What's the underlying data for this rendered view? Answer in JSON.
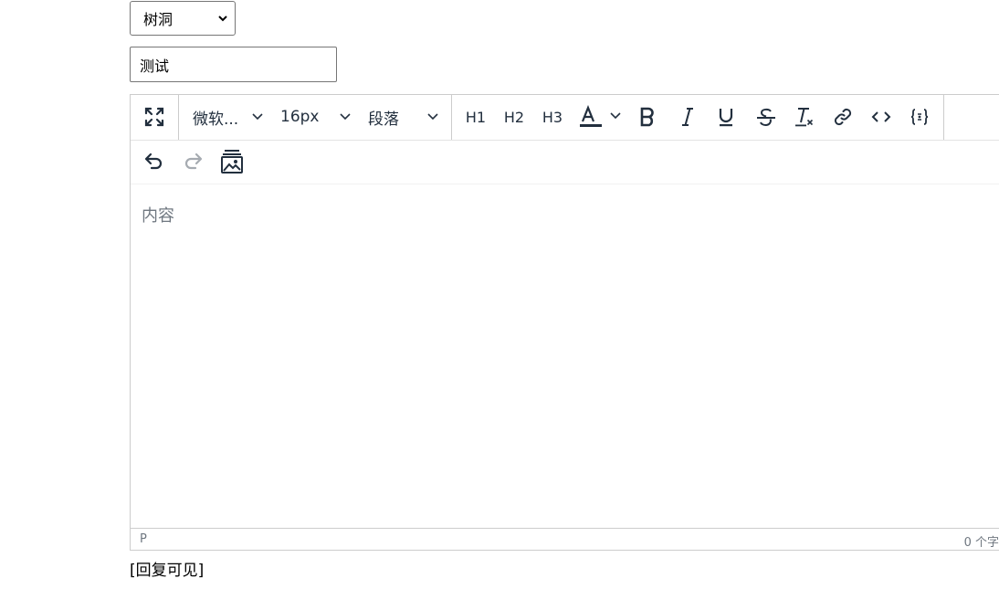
{
  "board_select": {
    "value": "树洞"
  },
  "title_input": {
    "value": "测试"
  },
  "toolbar": {
    "font_family": "微软...",
    "font_size": "16px",
    "block_format": "段落",
    "h1": "H1",
    "h2": "H2",
    "h3": "H3",
    "icons": [
      "fullscreen-icon",
      "text-color-icon",
      "bold-icon",
      "italic-icon",
      "underline-icon",
      "strikethrough-icon",
      "clear-format-icon",
      "link-icon",
      "code-icon",
      "code-block-icon",
      "undo-icon",
      "redo-icon",
      "image-icon"
    ]
  },
  "editor": {
    "placeholder": "内容",
    "status_path": "P",
    "word_count": "0 个字"
  },
  "footer": {
    "reply_visible": "[回复可见]"
  },
  "colors": {
    "icon": "#222f3e",
    "disabled": "#a6abb1",
    "border": "#cccccc",
    "placeholder": "#6f7780"
  }
}
